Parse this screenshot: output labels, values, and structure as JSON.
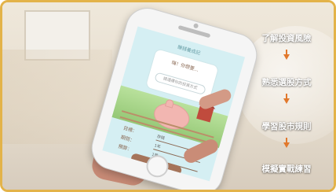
{
  "phone": {
    "app_title": "賺錢養成記",
    "bubble_title": "嗨！你想要...",
    "bubble_prompt": "請選擇你的投資方式",
    "form": [
      {
        "label": "目標：",
        "value": "存錢"
      },
      {
        "label": "期間：",
        "value": "1年"
      },
      {
        "label": "預算：",
        "value": "1萬"
      }
    ],
    "cta_label": "開始"
  },
  "steps": [
    {
      "label": "了解投資風險"
    },
    {
      "label": "熟悉選股方式"
    },
    {
      "label": "學習股市規則"
    },
    {
      "label": "模擬實戰練習"
    }
  ],
  "colors": {
    "frame_border": "#e3b349",
    "arrow": "#e1782c",
    "cta": "#a5745a"
  }
}
